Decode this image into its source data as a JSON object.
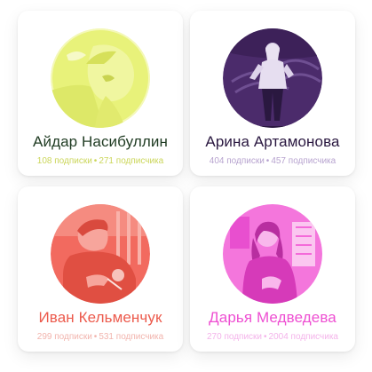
{
  "profiles": [
    {
      "name": "Айдар Насибуллин",
      "subscriptions": "108 подписки",
      "separator": "•",
      "subscribers": "271 подписчика",
      "accent": "#e6f06a",
      "name_color": "#1f3b22",
      "stats_color": "#cbd65a",
      "avatar_icon": "person-photo"
    },
    {
      "name": "Арина Артамонова",
      "subscriptions": "404 подписки",
      "separator": "•",
      "subscribers": "457 подписчика",
      "accent": "#4a2a6a",
      "name_color": "#2a1840",
      "stats_color": "#b7a3cf",
      "avatar_icon": "person-photo"
    },
    {
      "name": "Иван Кельменчук",
      "subscriptions": "299 подписки",
      "separator": "•",
      "subscribers": "531 подписчика",
      "accent": "#f0655a",
      "name_color": "#ec5a4c",
      "stats_color": "#f2b4ad",
      "avatar_icon": "person-photo"
    },
    {
      "name": "Дарья Медведева",
      "subscriptions": "270 подписки",
      "separator": "•",
      "subscribers": "2004 подписчика",
      "accent": "#f15ad8",
      "name_color": "#ee4fd2",
      "stats_color": "#f4b3ea",
      "avatar_icon": "person-photo"
    }
  ]
}
